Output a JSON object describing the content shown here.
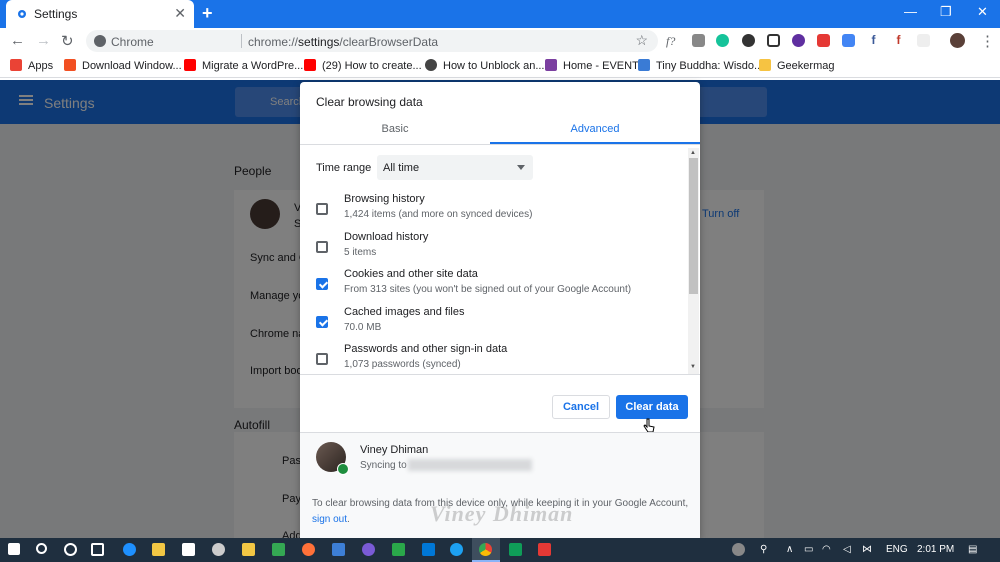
{
  "window": {
    "tab_title": "Settings",
    "new_tab": "+",
    "minimize": "—",
    "maximize": "❐",
    "close": "✕"
  },
  "toolbar": {
    "back": "←",
    "forward": "→",
    "reload": "↻",
    "origin": "Chrome",
    "url_scheme": "chrome://",
    "url_host": "settings",
    "url_path": "/clearBrowserData",
    "star": "☆",
    "ext_f": "f?",
    "menu": "⋮"
  },
  "bookmarks": [
    {
      "label": "Apps",
      "icon": "apps-grid-icon",
      "color": "#ea4335"
    },
    {
      "label": "Download Window...",
      "icon": "windows-icon",
      "color": "#f25022"
    },
    {
      "label": "Migrate a WordPre...",
      "icon": "youtube-icon",
      "color": "#ff0000"
    },
    {
      "label": "(29) How to create...",
      "icon": "youtube-icon",
      "color": "#ff0000"
    },
    {
      "label": "How to Unblock an...",
      "icon": "github-icon",
      "color": "#444444"
    },
    {
      "label": "Home - EVENT",
      "icon": "event-icon",
      "color": "#7b3fa0"
    },
    {
      "label": "Tiny Buddha: Wisdo...",
      "icon": "buddha-icon",
      "color": "#3a7bd5"
    },
    {
      "label": "Geekermag",
      "icon": "folder-icon",
      "color": "#f6c342"
    }
  ],
  "settings": {
    "header_title": "Settings",
    "search_placeholder": "Search",
    "people_heading": "People",
    "person_initial": "V",
    "person_sub": "S",
    "turn_off": "Turn off",
    "rows": [
      "Sync and G",
      "Manage yo",
      "Chrome na",
      "Import boo"
    ],
    "autofill_heading": "Autofill",
    "autofill_rows": [
      "Pas",
      "Pay",
      "Add"
    ]
  },
  "dialog": {
    "title": "Clear browsing data",
    "tabs": [
      {
        "label": "Basic",
        "active": false
      },
      {
        "label": "Advanced",
        "active": true
      }
    ],
    "time_range_label": "Time range",
    "time_range_value": "All time",
    "options": [
      {
        "title": "Browsing history",
        "subtitle": "1,424 items (and more on synced devices)",
        "checked": false
      },
      {
        "title": "Download history",
        "subtitle": "5 items",
        "checked": false
      },
      {
        "title": "Cookies and other site data",
        "subtitle": "From 313 sites (you won't be signed out of your Google Account)",
        "checked": true
      },
      {
        "title": "Cached images and files",
        "subtitle": "70.0 MB",
        "checked": true
      },
      {
        "title": "Passwords and other sign-in data",
        "subtitle": "1,073 passwords (synced)",
        "checked": false
      }
    ],
    "cancel_label": "Cancel",
    "clear_label": "Clear data",
    "account_name": "Viney Dhiman",
    "account_sync": "Syncing to",
    "footnote_text": "To clear browsing data from this device only, while keeping it in your Google Account,",
    "footnote_link": "sign out",
    "footnote_end": ".",
    "watermark": "Viney Dhiman"
  },
  "taskbar": {
    "lang": "ENG",
    "time": "2:01 PM",
    "accent": "#1a73e8"
  }
}
